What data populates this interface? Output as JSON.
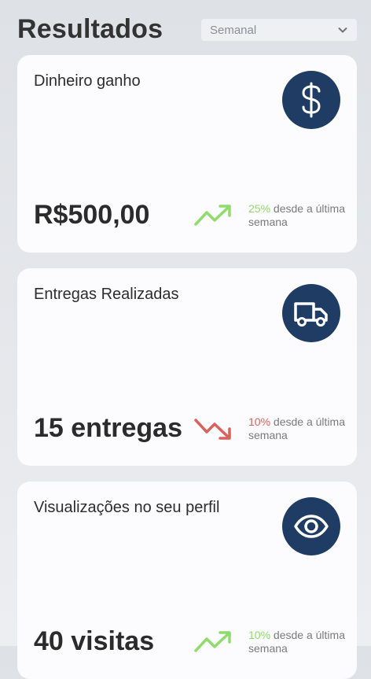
{
  "header": {
    "title": "Resultados",
    "period_select": {
      "value": "Semanal",
      "icon": "chevron-down-icon"
    }
  },
  "cards": [
    {
      "title": "Dinheiro ganho",
      "icon": "dollar-icon",
      "value": "R$500,00",
      "trend": {
        "direction": "up",
        "percent": "25%",
        "text": " desde a última semana",
        "color": "#8fdc6c"
      }
    },
    {
      "title": "Entregas Realizadas",
      "icon": "truck-icon",
      "value": "15 entregas",
      "trend": {
        "direction": "down",
        "percent": "10%",
        "text": " desde a última semana",
        "color": "#d9625a"
      }
    },
    {
      "title": "Visualizações no seu perfil",
      "icon": "eye-icon",
      "value": "40 visitas",
      "trend": {
        "direction": "up",
        "percent": "10%",
        "text": " desde a última semana",
        "color": "#8fdc6c"
      }
    }
  ],
  "colors": {
    "icon_bg": "#1f3d64",
    "card_bg": "#fcfbfd",
    "up": "#8fdc6c",
    "down": "#d9625a"
  }
}
